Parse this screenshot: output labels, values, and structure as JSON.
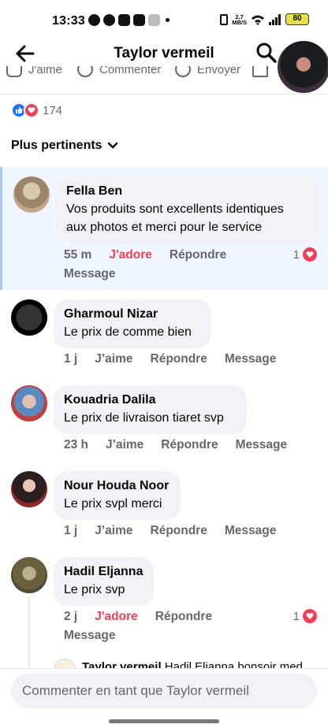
{
  "status": {
    "time": "13:33",
    "net_speed_top": "2,7",
    "net_speed_bottom": "MB/S",
    "battery": "80"
  },
  "header": {
    "title": "Taylor vermeil"
  },
  "actions": {
    "like": "J'aime",
    "comment": "Commenter",
    "send": "Envoyer"
  },
  "reactions": {
    "count": "174"
  },
  "sort": {
    "label": "Plus pertinents"
  },
  "comments": [
    {
      "name": "Fella Ben",
      "text_line1": "Vos produits sont excellents identiques",
      "text_line2": "aux photos et merci pour le service",
      "time": "55 m",
      "reaction": "J'adore",
      "reply": "Répondre",
      "message": "Message",
      "reaction_count": "1"
    },
    {
      "name": "Gharmoul Nizar",
      "text": "Le prix de comme bien",
      "time": "1 j",
      "reaction": "J’aime",
      "reply": "Répondre",
      "message": "Message"
    },
    {
      "name": "Kouadria Dalila",
      "text": "Le prix de livraison tiaret svp",
      "time": "23 h",
      "reaction": "J’aime",
      "reply": "Répondre",
      "message": "Message"
    },
    {
      "name": "Nour Houda Noor",
      "text": "Le prix svpl merci",
      "time": "1 j",
      "reaction": "J’aime",
      "reply": "Répondre",
      "message": "Message"
    },
    {
      "name": "Hadil Eljanna",
      "text": "Le prix svp",
      "time": "2 j",
      "reaction": "J'adore",
      "reply": "Répondre",
      "message": "Message",
      "reaction_count": "1"
    }
  ],
  "reply_preview": {
    "author": "Taylor vermeil",
    "text": "Hadil Eljanna bonsoir med"
  },
  "composer": {
    "placeholder": "Commenter en tant que Taylor vermeil"
  }
}
